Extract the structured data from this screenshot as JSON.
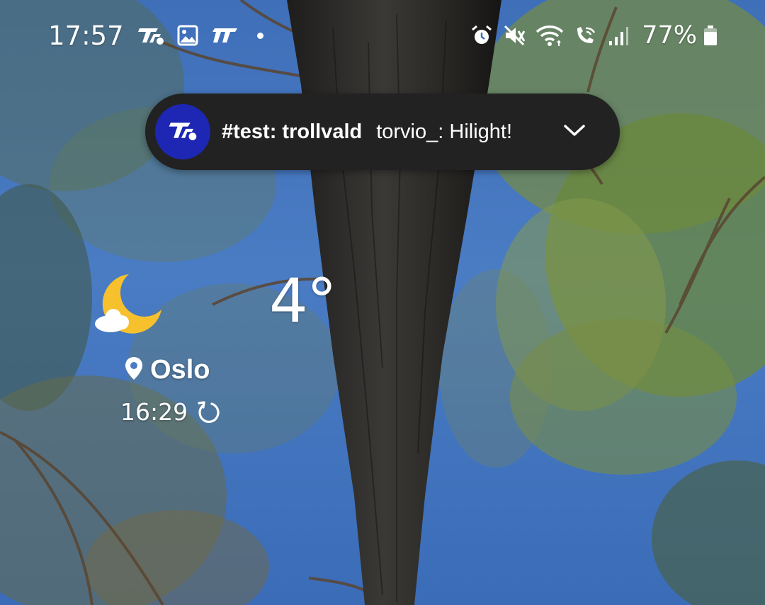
{
  "status_bar": {
    "time": "17:57",
    "battery_percent": "77%",
    "left_icons": [
      "irc-app-icon",
      "gallery-icon",
      "irc-app-icon-2",
      "notification-dot"
    ],
    "right_icons": [
      "alarm-icon",
      "mute-icon",
      "wifi-icon",
      "wifi-calling-icon",
      "signal-icon",
      "battery-icon"
    ]
  },
  "notification": {
    "title": "#test: trollvald",
    "body": "torvio_: Hilight!",
    "app_icon": "irc-app-icon",
    "colors": {
      "background": "#222222",
      "avatar": "#1d27b3"
    }
  },
  "weather": {
    "temperature": "4°",
    "location": "Oslo",
    "updated_time": "16:29",
    "condition_icon": "moon-cloud-icon"
  },
  "colors": {
    "sky": "#4a7cc4",
    "moon": "#f7c12e"
  }
}
